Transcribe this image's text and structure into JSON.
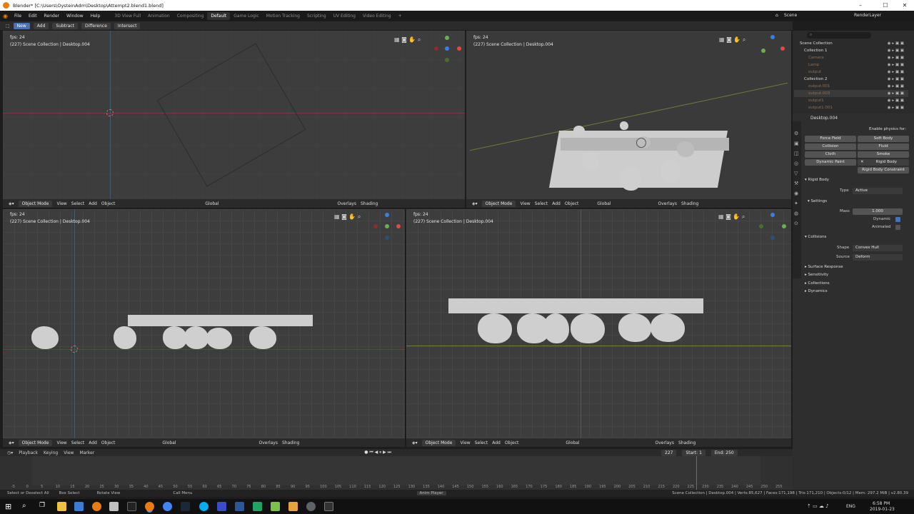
{
  "window": {
    "title": "Blender* [C:\\Users\\OysteinAdm\\Desktop\\Attempt2.blend1.blend]"
  },
  "menu": [
    "File",
    "Edit",
    "Render",
    "Window",
    "Help"
  ],
  "workspaces": [
    "3D View Full",
    "Animation",
    "Compositing",
    "Default",
    "Game Logic",
    "Motion Tracking",
    "Scripting",
    "UV Editing",
    "Video Editing",
    "+"
  ],
  "active_workspace": "Default",
  "scene": "Scene",
  "render_layer": "RenderLayer",
  "tool_header": {
    "new": "New",
    "add": "Add",
    "subtract": "Subtract",
    "difference": "Difference",
    "intersect": "Intersect"
  },
  "viewport": {
    "fps": "fps: 24",
    "info": "(227) Scene Collection | Desktop.004",
    "mode": "Object Mode",
    "view": "View",
    "select": "Select",
    "add": "Add",
    "object": "Object",
    "orientation": "Global",
    "overlays": "Overlays",
    "shading": "Shading"
  },
  "outliner": {
    "rows": [
      {
        "label": "Scene Collection",
        "dim": false
      },
      {
        "label": "Collection 1",
        "dim": false
      },
      {
        "label": "Camera",
        "dim": true
      },
      {
        "label": "Lamp",
        "dim": true
      },
      {
        "label": "output",
        "dim": true
      },
      {
        "label": "Collection 2",
        "dim": false
      },
      {
        "label": "output.001",
        "dim": true
      },
      {
        "label": "output.003",
        "dim": true
      },
      {
        "label": "output1",
        "dim": true
      },
      {
        "label": "output1.001",
        "dim": true
      }
    ]
  },
  "properties": {
    "object": "Desktop.004",
    "enable_physics": "Enable physics for:",
    "buttons": {
      "force_field": "Force Field",
      "soft_body": "Soft Body",
      "collision": "Collision",
      "fluid": "Fluid",
      "cloth": "Cloth",
      "smoke": "Smoke",
      "dynamic_paint": "Dynamic Paint",
      "rigid_body": "Rigid Body",
      "rigid_body_constraint": "Rigid Body Constraint"
    },
    "rigid_body_section": "Rigid Body",
    "type_label": "Type",
    "type_value": "Active",
    "settings_section": "Settings",
    "mass_label": "Mass",
    "mass_value": "1.000",
    "dynamic_label": "Dynamic",
    "animated_label": "Animated",
    "collisions_section": "Collisions",
    "shape_label": "Shape",
    "shape_value": "Convex Hull",
    "source_label": "Source",
    "source_value": "Deform",
    "surface_response": "Surface Response",
    "sensitivity": "Sensitivity",
    "collections": "Collections",
    "dynamics": "Dynamics"
  },
  "timeline": {
    "playback": "Playback",
    "keying": "Keying",
    "view": "View",
    "marker": "Marker",
    "current_frame": "227",
    "start_label": "Start:",
    "start": "1",
    "end_label": "End:",
    "end": "250",
    "ticks": [
      "-5",
      "0",
      "5",
      "10",
      "15",
      "20",
      "25",
      "30",
      "35",
      "40",
      "45",
      "50",
      "55",
      "60",
      "65",
      "70",
      "75",
      "80",
      "85",
      "90",
      "95",
      "100",
      "105",
      "110",
      "115",
      "120",
      "125",
      "130",
      "135",
      "140",
      "145",
      "150",
      "155",
      "160",
      "165",
      "170",
      "175",
      "180",
      "185",
      "190",
      "195",
      "200",
      "205",
      "210",
      "215",
      "220",
      "225",
      "230",
      "235",
      "240",
      "245",
      "250",
      "255"
    ],
    "playhead_frame": 227
  },
  "statusbar": {
    "select": "Select or Deselect All",
    "box": "Box Select",
    "rotate": "Rotate View",
    "call_menu": "Call Menu",
    "anim_player": "Anim Player",
    "stats": "Scene Collection | Desktop.004 | Verts:85,627 | Faces:171,198 | Tris:171,210 | Objects:0/12 | Mem: 297.2 MiB | v2.80.39"
  },
  "taskbar": {
    "time": "6:58 PM",
    "date": "2019-01-23",
    "lang": "ENG"
  }
}
